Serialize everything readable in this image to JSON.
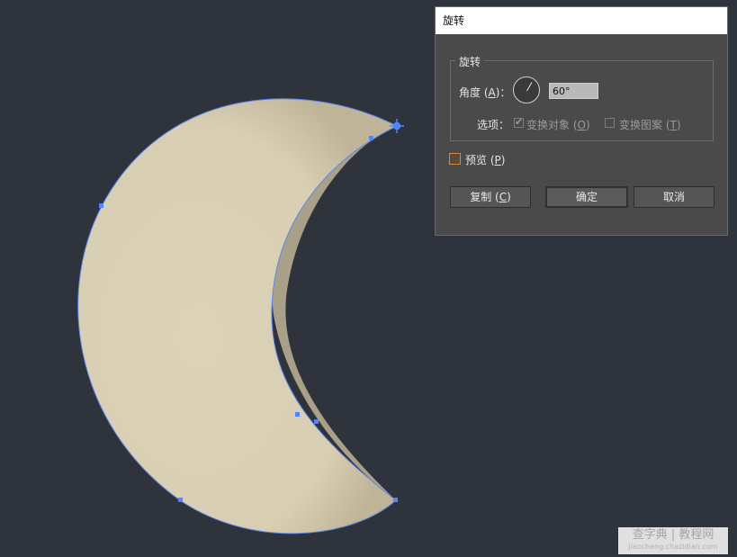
{
  "dialog": {
    "title": "旋转",
    "group_label": "旋转",
    "angle_label": "角度 (",
    "angle_key": "A",
    "angle_suffix": ")：",
    "angle_value": "60°",
    "options_label": "选项：",
    "transform_objects_label": "变换对象 (",
    "transform_objects_key": "O",
    "transform_objects_checked": true,
    "transform_patterns_label": "变换图案 (",
    "transform_patterns_key": "T",
    "transform_patterns_checked": false,
    "close_paren": ")",
    "preview_label": "预览 (",
    "preview_key": "P",
    "preview_checked": false,
    "copy_label": "复制 (",
    "copy_key": "C",
    "ok_label": "确定",
    "cancel_label": "取消"
  },
  "watermark": {
    "line1": "查字典 | 教程网",
    "line2": "jiaocheng.chazidian.com"
  },
  "colors": {
    "canvas_bg": "#2f333b",
    "moon_fill": "#dcd2b8",
    "moon_inner_shade": "#a9a08a",
    "selection_blue": "#4f86ff",
    "accent_orange": "#d6893a"
  }
}
